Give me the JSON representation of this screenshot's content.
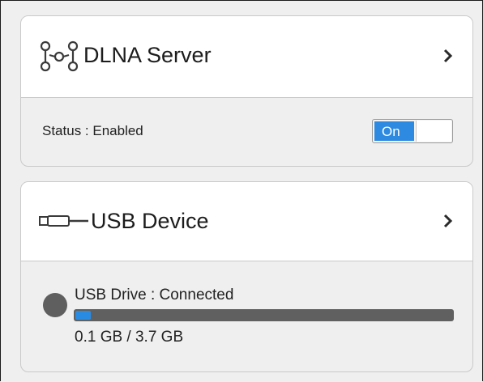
{
  "dlna": {
    "title": "DLNA Server",
    "icon": "network-nodes-icon",
    "status_text": "Status : Enabled",
    "toggle_label": "On",
    "toggle_on": true
  },
  "usb": {
    "title": "USB Device",
    "icon": "usb-plug-icon",
    "drive_text": "USB Drive : Connected",
    "usage_text": "0.1 GB / 3.7 GB",
    "used_fraction": 0.027,
    "status_dot_color": "#5f5f5f"
  },
  "colors": {
    "accent": "#2d8ae0",
    "background": "#efefef"
  }
}
